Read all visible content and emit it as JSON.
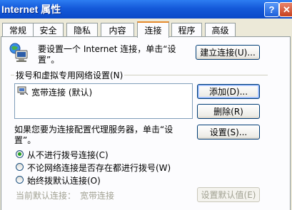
{
  "window": {
    "title": "Internet 属性",
    "help_glyph": "?",
    "close_glyph": "✕"
  },
  "tabs": [
    {
      "label": "常规"
    },
    {
      "label": "安全"
    },
    {
      "label": "隐私"
    },
    {
      "label": "内容"
    },
    {
      "label": "连接",
      "active": true
    },
    {
      "label": "程序"
    },
    {
      "label": "高级"
    }
  ],
  "setup": {
    "text": "要设置一个 Internet 连接，单击“设置”。",
    "button": "建立连接(U)..."
  },
  "dialup": {
    "group_label": "拨号和虚拟专用网络设置(N)",
    "connections": [
      {
        "name": "宽带连接 (默认)"
      }
    ],
    "add_button": "添加(D)...",
    "remove_button": "删除(R)"
  },
  "proxy": {
    "text": "如果您要为连接配置代理服务器，单击“设置”。",
    "settings_button": "设置(S)..."
  },
  "dial_options": [
    {
      "label": "从不进行拨号连接(C)",
      "checked": true
    },
    {
      "label": "不论网络连接是否存在都进行拨号(W)",
      "checked": false
    },
    {
      "label": "始终拨默认连接(O)",
      "checked": false
    }
  ],
  "default_connection": {
    "label": "当前默认连接：",
    "value": "宽带连接",
    "set_default_button": "设置默认值(E)"
  },
  "colors": {
    "titlebar": "#0A49C8",
    "active_tab_highlight": "#E68B2C",
    "dialog_face": "#ECE9D8"
  }
}
